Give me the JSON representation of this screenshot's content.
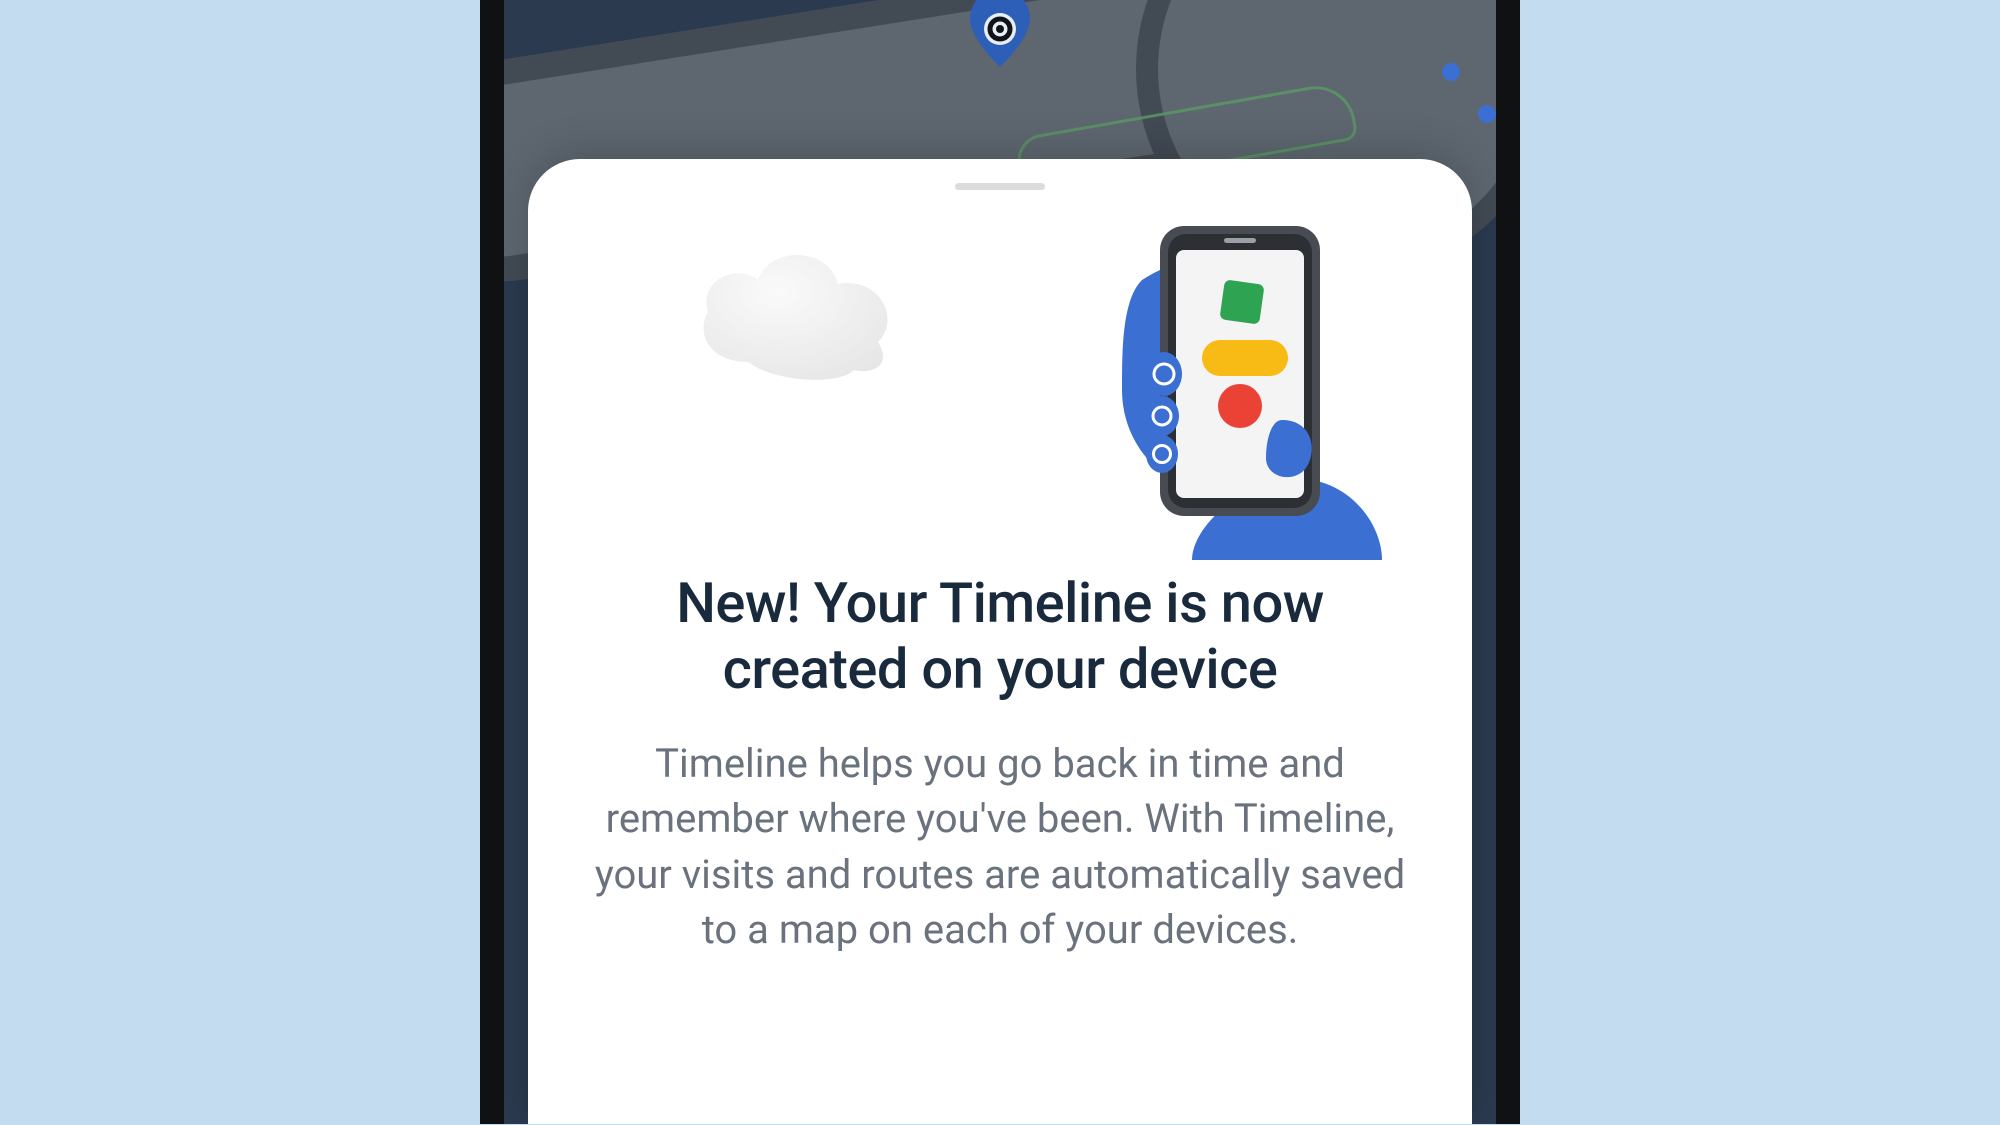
{
  "sheet": {
    "title": "New! Your Timeline is now created on your device",
    "body": "Timeline helps you go back in time and remember where you've been.  With Timeline, your visits and routes are automatically saved to a map on each of your devices."
  },
  "icons": {
    "cloud": "cloud-icon",
    "phone_in_hand": "phone-hand-icon",
    "map_pin": "map-pin-icon",
    "location_dot": "location-dot-icon",
    "drag_handle": "drag-handle-icon"
  },
  "colors": {
    "page_bg": "#c3dcf0",
    "device_frame": "#0f1113",
    "map_bg": "#2b3a4f",
    "road": "#5e6770",
    "sheet_bg": "#ffffff",
    "title": "#1a2a3d",
    "body_text": "#6a737d",
    "accent_blue": "#3b6fd1",
    "accent_green": "#2ea352",
    "accent_yellow": "#f8bb16",
    "accent_red": "#ea4335"
  }
}
